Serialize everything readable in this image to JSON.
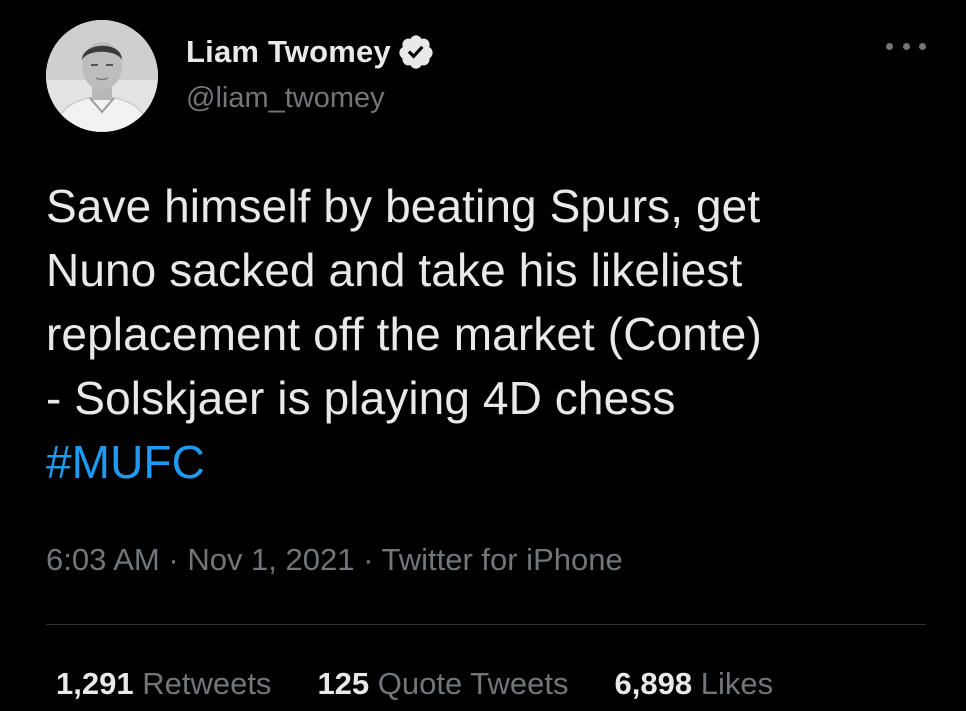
{
  "author": {
    "display_name": "Liam Twomey",
    "handle": "@liam_twomey",
    "verified": true
  },
  "tweet": {
    "lines": [
      "Save himself by beating Spurs, get",
      "Nuno sacked and take his likeliest",
      "replacement off the market (Conte)",
      "- Solskjaer is playing 4D chess"
    ],
    "hashtag": "#MUFC"
  },
  "meta": {
    "time": "6:03 AM",
    "separator": " · ",
    "date": "Nov 1, 2021",
    "source": "Twitter for iPhone"
  },
  "stats": {
    "retweets": {
      "count": "1,291",
      "label": "Retweets"
    },
    "quote_tweets": {
      "count": "125",
      "label": "Quote Tweets"
    },
    "likes": {
      "count": "6,898",
      "label": "Likes"
    }
  },
  "icons": {
    "verified": "verified-badge-icon",
    "more": "more-options-icon"
  },
  "colors": {
    "background": "#000000",
    "text": "#e7e9ea",
    "secondary": "#71767b",
    "link": "#1d9bf0",
    "divider": "#2f3336"
  }
}
